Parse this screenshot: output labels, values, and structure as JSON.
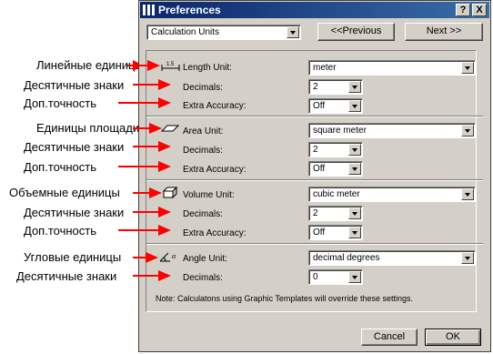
{
  "annotations": [
    {
      "text": "Линейные единицы"
    },
    {
      "text": "Десятичные знаки"
    },
    {
      "text": "Доп.точность"
    },
    {
      "text": "Единицы площади"
    },
    {
      "text": "Десятичные знаки"
    },
    {
      "text": "Доп.точность"
    },
    {
      "text": "Объемные единицы"
    },
    {
      "text": "Десятичные знаки"
    },
    {
      "text": "Доп.точность"
    },
    {
      "text": "Угловые единицы"
    },
    {
      "text": "Десятичные знаки"
    }
  ],
  "dialog": {
    "title": "Preferences",
    "help_label": "?",
    "close_label": "X",
    "page_select": "Calculation Units",
    "prev_label": "<<Previous",
    "next_label": "Next >>",
    "length": {
      "label": "Length Unit:",
      "value": "meter",
      "decimals_label": "Decimals:",
      "decimals": "2",
      "accuracy_label": "Extra Accuracy:",
      "accuracy": "Off"
    },
    "area": {
      "label": "Area Unit:",
      "value": "square meter",
      "decimals_label": "Decimals:",
      "decimals": "2",
      "accuracy_label": "Extra Accuracy:",
      "accuracy": "Off"
    },
    "volume": {
      "label": "Volume Unit:",
      "value": "cubic meter",
      "decimals_label": "Decimals:",
      "decimals": "2",
      "accuracy_label": "Extra Accuracy:",
      "accuracy": "Off"
    },
    "angle": {
      "label": "Angle Unit:",
      "value": "decimal degrees",
      "decimals_label": "Decimals:",
      "decimals": "0"
    },
    "angle_icon_text": "α",
    "note": "Note:  Calculatons using Graphic Templates will override these settings.",
    "cancel_label": "Cancel",
    "ok_label": "OK"
  },
  "colors": {
    "arrow": "#ff0000",
    "titlebar": "#0a246a",
    "face": "#d4d0c8"
  }
}
